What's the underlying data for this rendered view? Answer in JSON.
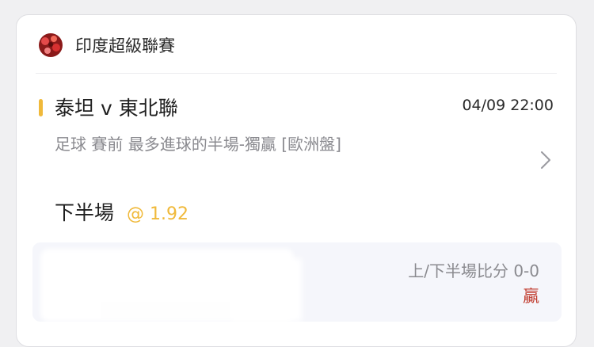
{
  "league": {
    "name": "印度超級聯賽",
    "logo_icon": "league-logo-icon"
  },
  "match": {
    "title": "泰坦 v 東北聯",
    "time": "04/09 22:00",
    "market": "足球  賽前   最多進球的半場-獨贏  [歐洲盤]",
    "selection": "下半場",
    "odds": "@ 1.92"
  },
  "result": {
    "score": "上/下半場比分 0-0",
    "outcome": "贏"
  },
  "colors": {
    "accent": "#f0b93a",
    "win": "#c0392b"
  }
}
